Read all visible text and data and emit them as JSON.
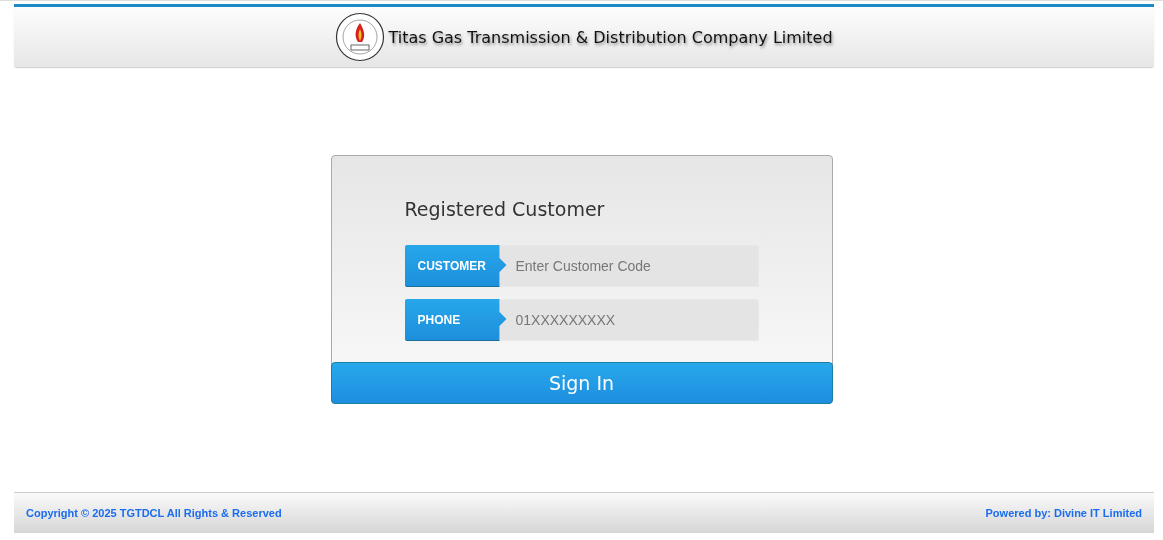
{
  "header": {
    "title": "Titas Gas Transmission & Distribution Company Limited"
  },
  "login": {
    "title": "Registered Customer",
    "fields": [
      {
        "label": "CUSTOMER",
        "placeholder": "Enter Customer Code"
      },
      {
        "label": "PHONE",
        "placeholder": "01XXXXXXXXX"
      }
    ],
    "button": "Sign In"
  },
  "footer": {
    "copyright": "Copyright © 2025 TGTDCL All Rights & Reserved",
    "powered_by": "Powered by: Divine IT Limited"
  }
}
